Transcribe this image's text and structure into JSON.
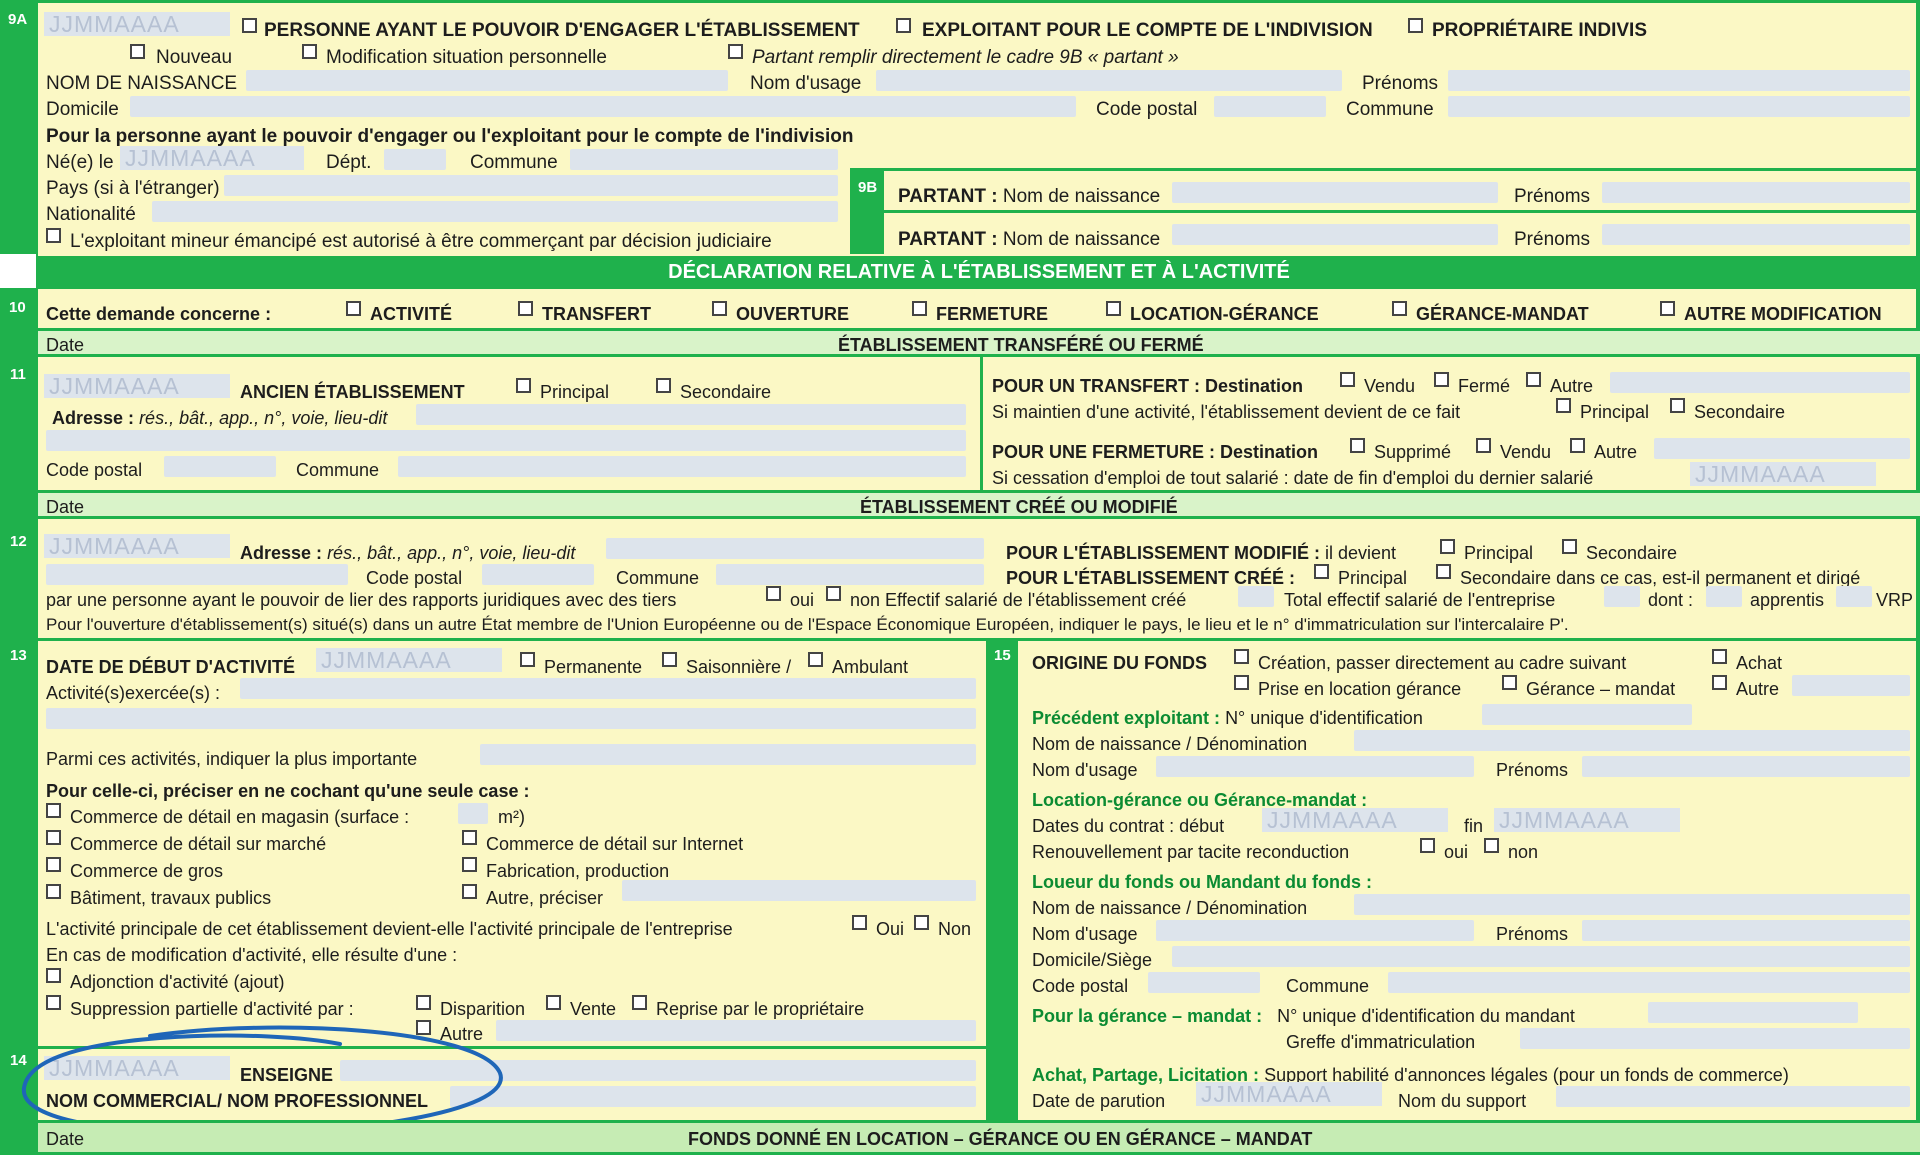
{
  "date_ph": "JJMMAAAA",
  "numbers": {
    "n9a": "9A",
    "n9b": "9B",
    "n10": "10",
    "n11": "11",
    "n12": "12",
    "n13": "13",
    "n14": "14",
    "n15": "15"
  },
  "s9a": {
    "personne": "PERSONNE AYANT LE POUVOIR D'ENGAGER L'ÉTABLISSEMENT",
    "exploitant": "EXPLOITANT POUR LE COMPTE DE L'INDIVISION",
    "proprietaire": "PROPRIÉTAIRE INDIVIS",
    "nouveau": "Nouveau",
    "modification": "Modification situation personnelle",
    "partant": "Partant remplir directement le cadre 9B « partant »",
    "nom_naissance": "NOM DE NAISSANCE",
    "nom_usage": "Nom d'usage",
    "prenoms": "Prénoms",
    "domicile": "Domicile",
    "code_postal": "Code postal",
    "commune": "Commune",
    "pour_personne": "Pour la personne ayant le pouvoir d'engager ou l'exploitant pour le compte de l'indivision",
    "ne_le": "Né(e) le",
    "dept": "Dépt.",
    "commune2": "Commune",
    "pays": "Pays (si à l'étranger)",
    "nationalite": "Nationalité",
    "mineur": "L'exploitant mineur émancipé est autorisé à être commerçant par décision judiciaire"
  },
  "s9b": {
    "partant_label": "PARTANT :",
    "nom_naissance": "Nom de naissance",
    "prenoms": "Prénoms"
  },
  "declaration_title": "DÉCLARATION RELATIVE À L'ÉTABLISSEMENT ET À L'ACTIVITÉ",
  "s10": {
    "demande": "Cette demande concerne :",
    "options": [
      "ACTIVITÉ",
      "TRANSFERT",
      "OUVERTURE",
      "FERMETURE",
      "LOCATION-GÉRANCE",
      "GÉRANCE-MANDAT",
      "AUTRE MODIFICATION"
    ]
  },
  "date_label": "Date",
  "etab_transfere": "ÉTABLISSEMENT TRANSFÉRÉ OU FERMÉ",
  "s11": {
    "ancien": "ANCIEN ÉTABLISSEMENT",
    "principal": "Principal",
    "secondaire": "Secondaire",
    "adresse": "Adresse :",
    "adresse_hint": "rés., bât., app., n°, voie, lieu-dit",
    "code_postal": "Code postal",
    "commune": "Commune",
    "transfert": "POUR UN TRANSFERT :",
    "destination": "Destination",
    "vendu": "Vendu",
    "ferme": "Fermé",
    "autre": "Autre",
    "maintien": "Si maintien d'une activité, l'établissement devient de ce fait",
    "fermeture": "POUR UNE FERMETURE :",
    "supprime": "Supprimé",
    "cessation": "Si cessation d'emploi de tout salarié : date de fin d'emploi du dernier salarié"
  },
  "etab_cree": "ÉTABLISSEMENT CRÉÉ OU MODIFIÉ",
  "s12": {
    "adresse": "Adresse :",
    "adresse_hint": "rés., bât., app., n°, voie, lieu-dit",
    "code_postal": "Code postal",
    "commune": "Commune",
    "modifie": "POUR L'ÉTABLISSEMENT MODIFIÉ :",
    "il_devient": "il devient",
    "principal": "Principal",
    "secondaire": "Secondaire",
    "cree": "POUR L'ÉTABLISSEMENT CRÉÉ :",
    "secondaire_cas": "Secondaire dans ce cas, est-il permanent et dirigé",
    "par_personne": "par une personne ayant le pouvoir de lier des rapports juridiques avec des tiers",
    "oui": "oui",
    "non_effectif": "non Effectif salarié de l'établissement créé",
    "total": "Total effectif salarié de l'entreprise",
    "dont": "dont :",
    "apprentis": "apprentis",
    "vrp": "VRP",
    "ouverture": "Pour l'ouverture d'établissement(s) situé(s) dans un autre État membre de l'Union Européenne ou de l'Espace Économique Européen, indiquer le pays, le lieu et le n° d'immatriculation sur l'intercalaire P'."
  },
  "s13": {
    "date_debut": "DATE DE DÉBUT D'ACTIVITÉ",
    "permanente": "Permanente",
    "saisonniere": "Saisonnière /",
    "ambulant": "Ambulant",
    "activites": "Activité(s)exercée(s) :",
    "parmi": "Parmi ces activités, indiquer la plus importante",
    "pour_celle": "Pour celle-ci, préciser en ne cochant qu'une seule case :",
    "magasin": "Commerce de détail en magasin (surface :",
    "m2": "m²)",
    "marche": "Commerce de détail sur marché",
    "internet": "Commerce de détail sur Internet",
    "gros": "Commerce de gros",
    "fabrication": "Fabrication, production",
    "batiment": "Bâtiment, travaux publics",
    "autre": "Autre, préciser",
    "principale": "L'activité principale de cet établissement devient-elle l'activité principale de l'entreprise",
    "oui": "Oui",
    "non": "Non",
    "cas_modif": "En cas de modification d'activité, elle résulte d'une :",
    "adjonction": "Adjonction d'activité (ajout)",
    "suppression": "Suppression partielle d'activité par :",
    "disparition": "Disparition",
    "vente": "Vente",
    "reprise": "Reprise par le propriétaire",
    "autre2": "Autre"
  },
  "s14": {
    "enseigne": "ENSEIGNE",
    "nom_commercial": "NOM COMMERCIAL/ NOM PROFESSIONNEL"
  },
  "s15": {
    "origine": "ORIGINE DU FONDS",
    "creation": "Création, passer directement au cadre suivant",
    "achat": "Achat",
    "location": "Prise en location gérance",
    "gerance": "Gérance – mandat",
    "autre": "Autre",
    "precedent": "Précédent exploitant :",
    "numero": "N° unique d'identification",
    "nom_denom": "Nom de naissance / Dénomination",
    "nom_usage": "Nom d'usage",
    "prenoms": "Prénoms",
    "location_gerance": "Location-gérance ou Gérance-mandat :",
    "dates_contrat": "Dates du contrat : début",
    "fin": "fin",
    "renouvellement": "Renouvellement par tacite reconduction",
    "oui": "oui",
    "non": "non",
    "loueur": "Loueur du fonds ou Mandant du fonds :",
    "domicile": "Domicile/Siège",
    "code_postal": "Code postal",
    "commune": "Commune",
    "gerance_mandat": "Pour la gérance – mandat :",
    "numero_mandant": "N° unique d'identification du mandant",
    "greffe": "Greffe d'immatriculation",
    "achat_partage": "Achat, Partage, Licitation :",
    "support": "Support habilité d'annonces légales (pour un fonds de commerce)",
    "date_parution": "Date de parution",
    "nom_support": "Nom du support"
  },
  "fonds_title": "FONDS DONNÉ EN LOCATION – GÉRANCE OU EN GÉRANCE – MANDAT",
  "colors": {
    "green": "#1fb14c",
    "paper": "#fbf8c5",
    "field": "#dde4ec",
    "ink_circle": "#1f66b8"
  }
}
